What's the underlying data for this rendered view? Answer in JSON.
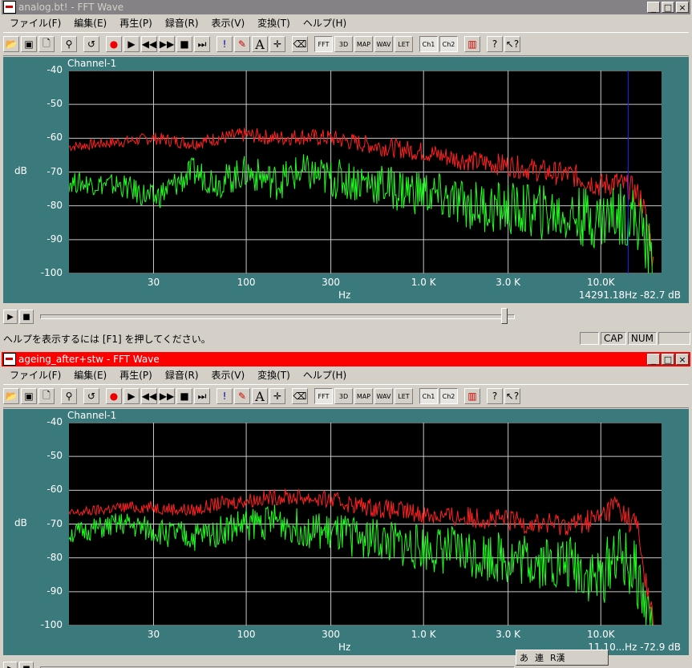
{
  "windows": [
    {
      "title": "analog.bt! - FFT Wave",
      "channel_label": "Channel-1",
      "y_unit": "dB",
      "x_unit": "Hz",
      "cursor_readout": "14291.18Hz  -82.7  dB",
      "status_text": "ヘルプを表示するには [F1] を押してください。",
      "status_panels": [
        "",
        "CAP",
        "NUM",
        ""
      ]
    },
    {
      "title": "ageing_after+stw - FFT Wave",
      "channel_label": "Channel-1",
      "y_unit": "dB",
      "x_unit": "Hz",
      "cursor_readout": "11.10...Hz  -72.9  dB"
    }
  ],
  "menu": [
    "ファイル(F)",
    "編集(E)",
    "再生(P)",
    "録音(R)",
    "表示(V)",
    "変換(T)",
    "ヘルプ(H)"
  ],
  "window_buttons": [
    "_",
    "□",
    "×"
  ],
  "toolbar": {
    "icons": [
      "open-icon",
      "save-icon",
      "preview-icon",
      "find-icon",
      "undo-icon",
      "record-icon",
      "play-icon",
      "rewind-icon",
      "fast-forward-icon",
      "stop-icon",
      "go-end-icon",
      "exclaim-icon",
      "pencil-icon",
      "text-icon",
      "crosshair-icon",
      "eraser-icon"
    ],
    "mode_buttons": [
      "FFT",
      "3D",
      "MAP",
      "WAV",
      "LET"
    ],
    "channel_buttons": [
      "Ch1",
      "Ch2"
    ]
  },
  "ime_bar": [
    "あ",
    "連",
    "R漢"
  ],
  "chart_data": [
    {
      "type": "line",
      "y_ticks": [
        "-40",
        "-50",
        "-60",
        "-70",
        "-80",
        "-90",
        "-100"
      ],
      "x_ticks": [
        "30",
        "100",
        "300",
        "1.0 K",
        "3.0 K",
        "10.0K"
      ],
      "xlabel": "Hz",
      "ylabel": "dB",
      "ylim": [
        -100,
        -40
      ],
      "xlim": [
        10,
        22000
      ],
      "x_scale": "log",
      "grid": true,
      "cursor_hz": 14291.18,
      "series": [
        {
          "color": "#ff2020",
          "x": [
            10,
            20,
            30,
            50,
            70,
            100,
            150,
            200,
            300,
            500,
            700,
            1000,
            1500,
            2000,
            3000,
            5000,
            7000,
            10000,
            12000,
            15000,
            17000,
            19000,
            20000
          ],
          "values": [
            -62.5,
            -61,
            -60,
            -61.5,
            -60,
            -59,
            -60,
            -59.5,
            -60,
            -62,
            -63,
            -64,
            -66,
            -67,
            -68,
            -70,
            -71,
            -74,
            -73,
            -75,
            -78,
            -90,
            -100
          ]
        },
        {
          "color": "#20ff20",
          "x": [
            10,
            20,
            30,
            50,
            70,
            100,
            150,
            200,
            300,
            500,
            700,
            1000,
            1500,
            2000,
            3000,
            5000,
            7000,
            10000,
            12000,
            15000,
            17000,
            19000,
            20000
          ],
          "values": [
            -73,
            -74,
            -78,
            -70,
            -73,
            -70,
            -73,
            -70,
            -72,
            -73,
            -75,
            -76,
            -79,
            -80,
            -81,
            -82,
            -83,
            -84,
            -82,
            -83,
            -86,
            -95,
            -100
          ]
        }
      ]
    },
    {
      "type": "line",
      "y_ticks": [
        "-40",
        "-50",
        "-60",
        "-70",
        "-80",
        "-90",
        "-100"
      ],
      "x_ticks": [
        "30",
        "100",
        "300",
        "1.0 K",
        "3.0 K",
        "10.0K"
      ],
      "xlabel": "Hz",
      "ylabel": "dB",
      "ylim": [
        -100,
        -40
      ],
      "xlim": [
        10,
        22000
      ],
      "x_scale": "log",
      "grid": true,
      "series": [
        {
          "color": "#ff2020",
          "x": [
            10,
            20,
            30,
            50,
            70,
            100,
            150,
            200,
            300,
            500,
            700,
            1000,
            1500,
            2000,
            3000,
            5000,
            7000,
            10000,
            12000,
            14000,
            16000,
            18000,
            20000
          ],
          "values": [
            -67,
            -65,
            -65,
            -66,
            -64,
            -63,
            -62,
            -62,
            -63,
            -65,
            -66,
            -67,
            -68,
            -68,
            -69,
            -70,
            -70,
            -68,
            -64,
            -68,
            -70,
            -88,
            -100
          ]
        },
        {
          "color": "#20ff20",
          "x": [
            10,
            20,
            30,
            50,
            70,
            100,
            150,
            200,
            300,
            500,
            700,
            1000,
            1500,
            2000,
            3000,
            5000,
            7000,
            10000,
            12000,
            14000,
            16000,
            18000,
            20000
          ],
          "values": [
            -73,
            -70,
            -72,
            -74,
            -72,
            -70,
            -69,
            -71,
            -73,
            -74,
            -76,
            -77,
            -78,
            -79,
            -80,
            -81,
            -82,
            -87,
            -78,
            -82,
            -85,
            -95,
            -100
          ]
        }
      ]
    }
  ]
}
